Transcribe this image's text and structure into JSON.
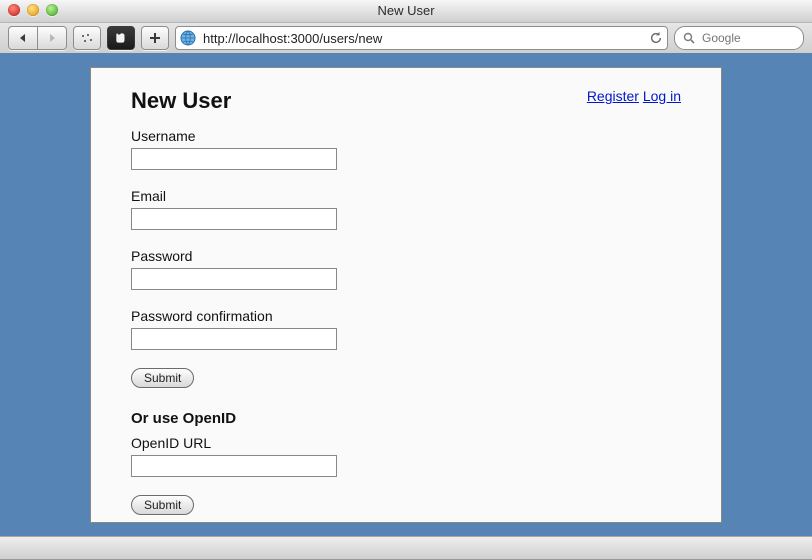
{
  "window": {
    "title": "New User"
  },
  "toolbar": {
    "url": "http://localhost:3000/users/new",
    "search_placeholder": "Google"
  },
  "header": {
    "links": {
      "register": "Register",
      "login": "Log in"
    }
  },
  "form": {
    "heading": "New User",
    "username": {
      "label": "Username",
      "value": ""
    },
    "email": {
      "label": "Email",
      "value": ""
    },
    "password": {
      "label": "Password",
      "value": ""
    },
    "password_confirmation": {
      "label": "Password confirmation",
      "value": ""
    },
    "submit1": "Submit",
    "openid_heading": "Or use OpenID",
    "openid_url": {
      "label": "OpenID URL",
      "value": ""
    },
    "submit2": "Submit"
  }
}
